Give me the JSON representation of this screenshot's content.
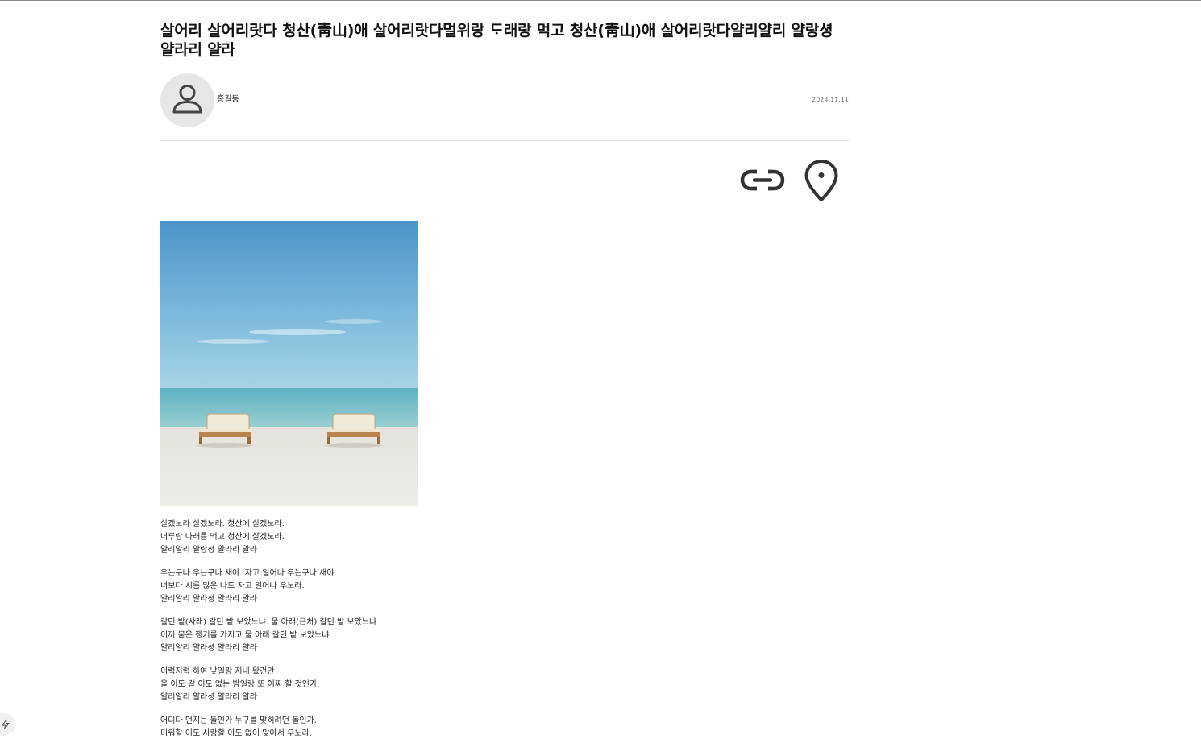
{
  "post": {
    "title": "살어리 살어리랏다 청산(靑山)애 살어리랏다멀위랑 ᄃᆞ래랑 먹고 청산(靑山)애 살어리랏다얄리얄리 얄랑셩 얄라리 얄라",
    "author": "홍길동",
    "date": "2024.11.11"
  },
  "icons": {
    "avatar": "person-icon",
    "link": "link-icon",
    "location": "location-pin-icon",
    "badge": "lightning-icon"
  },
  "photo": {
    "subject": "two beach chairs on white sand facing the sea"
  },
  "body": {
    "stanzas": [
      {
        "lines": [
          "살겠노라 살겠노라. 청산에 살겠노라.",
          "머루랑 다래를 먹고 청산에 살겠노라.",
          "얄리얄리 얄랑셩 얄라리 얄라"
        ]
      },
      {
        "lines": [
          "우는구나 우는구나 새야. 자고 일어나 우는구나 새야.",
          "너보다 시름 많은 나도 자고 일어나 우노라.",
          "얄리얄리 얄라셩 얄라리 얄라"
        ]
      },
      {
        "lines": [
          "갈던 밭(사래) 갈던 밭 보았느냐. 물 아래(근처) 갈던 밭 보았느냐",
          "이끼 묻은 쟁기를 가지고 물 아래 갈던 밭 보았느냐.",
          "얄리얄리 얄라셩 얄라리 얄라"
        ]
      },
      {
        "lines": [
          "이럭저럭 하여 낮일랑 지내 왔건만",
          "올 이도 갈 이도 없는 밤일랑 또 어찌 할 것인가.",
          "얄리얄리 얄라셩 얄라리 얄라"
        ]
      },
      {
        "lines": [
          "어디다 던지는 돌인가 누구를 맞히려던 돌인가.",
          "미워할 이도 사랑할 이도 없이 맞아서 우노라."
        ]
      }
    ]
  },
  "colors": {
    "sky_top": "#4d97cc",
    "sky_bottom": "#9fd0e4",
    "sea": "#7fc3cc",
    "sand": "#ece9e4",
    "icon": "#333333"
  }
}
